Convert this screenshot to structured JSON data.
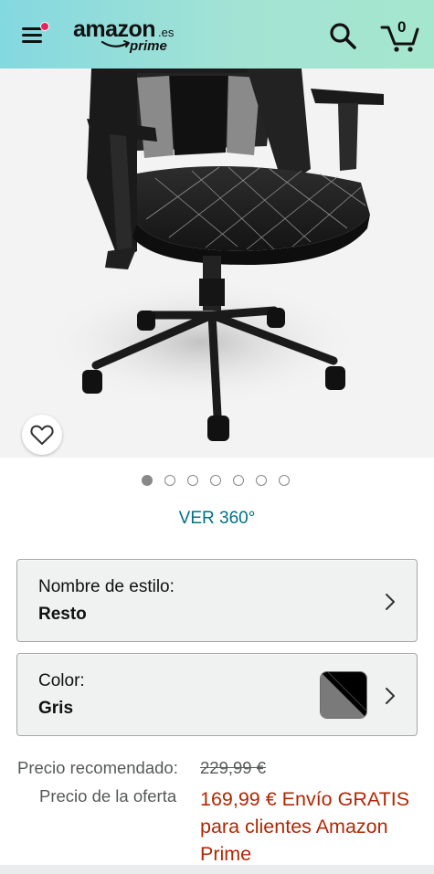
{
  "header": {
    "logo_word": "amazon",
    "logo_tld": ".es",
    "logo_sub": "prime",
    "cart_count": "0",
    "colors": {
      "gradient_start": "#84d8e0",
      "gradient_end": "#a5e6ce",
      "notification_dot": "#e3245e"
    },
    "icons": [
      "menu-icon",
      "search-icon",
      "cart-icon"
    ]
  },
  "product": {
    "image_icon": "gaming-chair-image",
    "wishlist_icon": "heart-icon",
    "carousel": {
      "total": 7,
      "active": 1
    },
    "view360_label": "VER 360°"
  },
  "variations": {
    "style": {
      "label": "Nombre de estilo:",
      "value": "Resto",
      "icon": "chevron-right-icon"
    },
    "color": {
      "label": "Color:",
      "value": "Gris",
      "icon": "chevron-right-icon",
      "swatch_colors": [
        "#000000",
        "#7a7a7a"
      ]
    }
  },
  "price": {
    "recommended_label": "Precio recomendado:",
    "recommended_value": "229,99 €",
    "offer_label": "Precio de la oferta",
    "offer_value": "169,99 € Envío GRATIS para clientes Amazon Prime",
    "offer_color": "#b12704",
    "link_color": "#007185"
  }
}
